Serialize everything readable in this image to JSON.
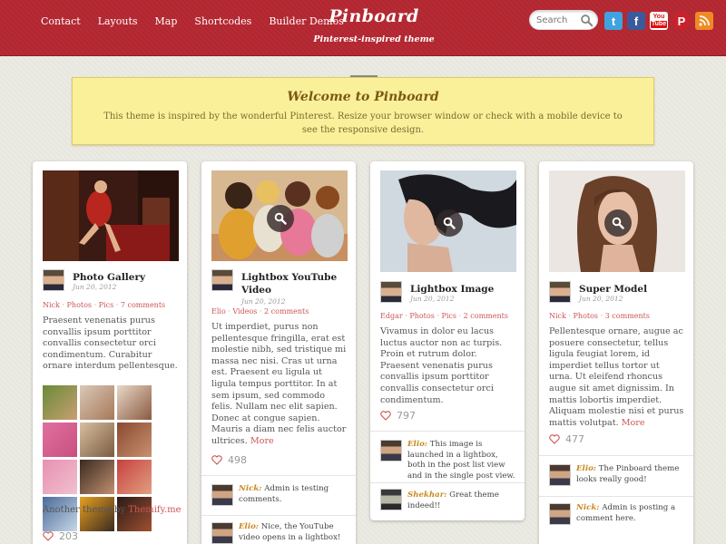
{
  "nav": {
    "items": [
      "Contact",
      "Layouts",
      "Map",
      "Shortcodes",
      "Builder Demos"
    ]
  },
  "logo": {
    "title": "Pinboard",
    "tagline": "Pinterest-inspired theme"
  },
  "search": {
    "placeholder": "Search"
  },
  "social": {
    "icons": [
      "twitter-icon",
      "facebook-icon",
      "youtube-icon",
      "pinterest-icon",
      "rss-icon"
    ]
  },
  "welcome": {
    "title": "Welcome to Pinboard",
    "text": "This theme is inspired by the wonderful Pinterest. Resize your browser window or check with a mobile device to see the responsive design."
  },
  "posts": [
    {
      "title": "Photo Gallery",
      "date": "Jun 20, 2012",
      "cats": [
        "Nick",
        "Photos",
        "Pics",
        "7 comments"
      ],
      "excerpt": "Praesent venenatis purus convallis ipsum porttitor convallis consectetur orci condimentum. Curabitur ornare interdum pellentesque.",
      "more": "",
      "likes": "203",
      "footer_text": "Another theme by ",
      "footer_link": "Themify.me"
    },
    {
      "title": "Lightbox YouTube Video",
      "date": "Jun 20, 2012",
      "cats": [
        "Elio",
        "Videos",
        "2 comments"
      ],
      "excerpt": "Ut imperdiet, purus non pellentesque fringilla, erat est molestie nibh, sed tristique mi massa nec nisi. Cras ut urna est. Praesent eu ligula ut ligula tempus porttitor. In at sem ipsum, sed commodo felis. Nullam nec elit sapien. Donec at congue sapien. Mauris a diam nec felis auctor ultrices.",
      "more": "More",
      "likes": "498",
      "comments": [
        {
          "author": "Nick:",
          "text": "Admin is testing comments."
        },
        {
          "author": "Elio:",
          "text": "Nice, the YouTube video opens in a lightbox!"
        }
      ]
    },
    {
      "title": "Lightbox Image",
      "date": "Jun 20, 2012",
      "cats": [
        "Edgar",
        "Photos",
        "Pics",
        "2 comments"
      ],
      "excerpt": "Vivamus in dolor eu lacus luctus auctor non ac turpis. Proin et rutrum dolor. Praesent venenatis purus convallis ipsum porttitor convallis consectetur orci condimentum.",
      "more": "",
      "likes": "797",
      "comments": [
        {
          "author": "Elio:",
          "text": "This image is launched in a lightbox, both in the post list view and in the single post view."
        },
        {
          "author": "Shekhar:",
          "text": "Great theme indeed!!"
        }
      ]
    },
    {
      "title": "Super Model",
      "date": "Jun 20, 2012",
      "cats": [
        "Nick",
        "Photos",
        "3 comments"
      ],
      "excerpt": "Pellentesque ornare, augue ac posuere consectetur, tellus ligula feugiat lorem, id imperdiet tellus tortor ut urna. Ut eleifend rhoncus augue sit amet dignissim. In mattis lobortis imperdiet. Aliquam molestie nisi et purus mattis volutpat.",
      "more": "More",
      "likes": "477",
      "comments": [
        {
          "author": "Elio:",
          "text": "The Pinboard theme looks really good!"
        },
        {
          "author": "Nick:",
          "text": "Admin is posting a comment here."
        }
      ]
    }
  ],
  "colors": {
    "header": "#b82a34",
    "welcome_bg": "#fbf09a",
    "link": "#c55",
    "comment_author": "#c8891f"
  }
}
